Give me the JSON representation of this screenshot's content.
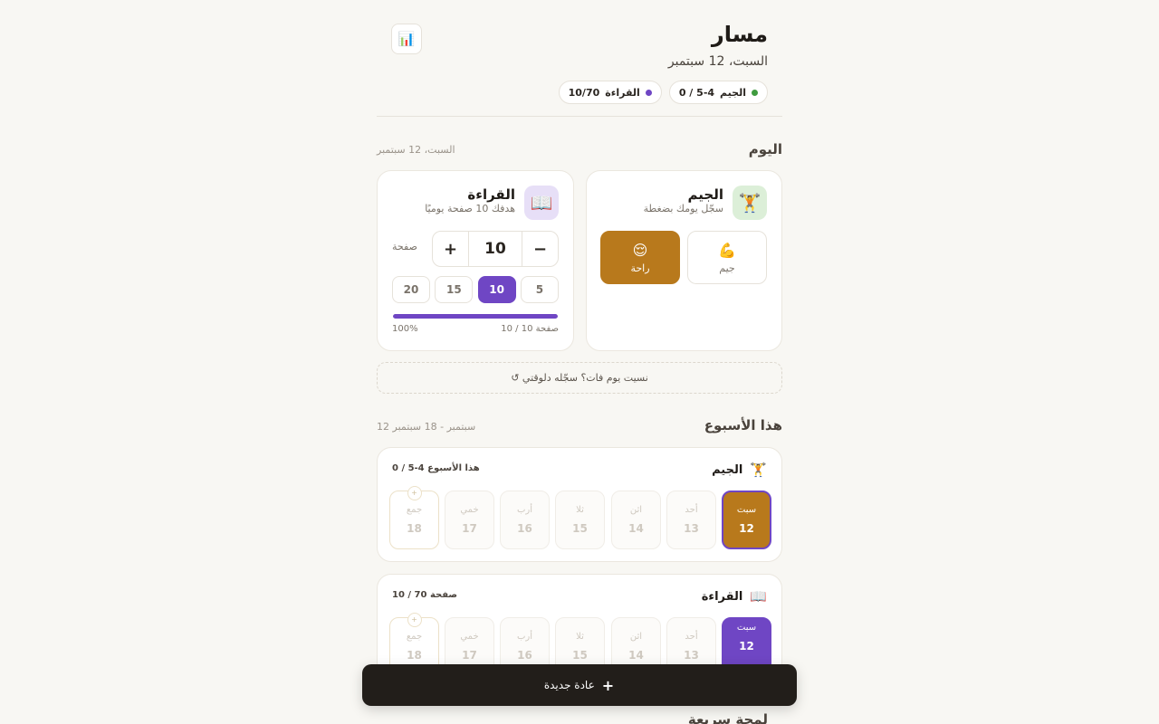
{
  "header": {
    "title": "مسار",
    "date": "السبت، 12 سبتمبر",
    "stats_icon": "📊",
    "pills": [
      {
        "name": "الجيم",
        "value": "0 / 5-4",
        "color": "#3f9b3f"
      },
      {
        "name": "القراءة",
        "value": "10/70",
        "color": "#6f46c4"
      }
    ]
  },
  "today": {
    "title": "اليوم",
    "date": "السبت، 12 سبتمبر",
    "gym": {
      "icon": "🏋️",
      "name": "الجيم",
      "desc": "سجّل يومك بضغطة",
      "options": [
        {
          "emoji": "💪",
          "label": "جيم",
          "active": false
        },
        {
          "emoji": "😌",
          "label": "راحة",
          "active": true
        }
      ]
    },
    "reading": {
      "icon": "📖",
      "name": "القراءة",
      "desc": "هدفك 10 صفحة يوميًا",
      "value": "10",
      "minus": "−",
      "plus": "+",
      "unit": "صفحة",
      "presets": [
        "5",
        "10",
        "15",
        "20"
      ],
      "active_preset": "10",
      "progress_text": "10 / 10 صفحة",
      "progress_pct": "100%",
      "progress_fraction": 1.0
    },
    "backfill": "↺ نسيت يوم فات؟ سجّله دلوقتي"
  },
  "week": {
    "title": "هذا الأسبوع",
    "range": "12 سبتمبر - 18 سبتمبر",
    "habits": [
      {
        "icon": "🏋️",
        "name": "الجيم",
        "progress": "0 / 5-4 هذا الأسبوع",
        "days": [
          {
            "name": "سبت",
            "num": "12"
          },
          {
            "name": "أحد",
            "num": "13"
          },
          {
            "name": "اثن",
            "num": "14"
          },
          {
            "name": "ثلا",
            "num": "15"
          },
          {
            "name": "أرب",
            "num": "16"
          },
          {
            "name": "خمي",
            "num": "17"
          },
          {
            "name": "جمع",
            "num": "18"
          }
        ]
      },
      {
        "icon": "📖",
        "name": "القراءة",
        "progress": "10 / 70 صفحة",
        "days": [
          {
            "name": "سبت",
            "num": "12"
          },
          {
            "name": "أحد",
            "num": "13"
          },
          {
            "name": "اثن",
            "num": "14"
          },
          {
            "name": "ثلا",
            "num": "15"
          },
          {
            "name": "أرب",
            "num": "16"
          },
          {
            "name": "خمي",
            "num": "17"
          },
          {
            "name": "جمع",
            "num": "18"
          }
        ]
      }
    ],
    "add_mark": "+"
  },
  "new_habit": {
    "label": "عادة جديدة",
    "icon": "+"
  },
  "quick_title": "لمحة سريعة"
}
